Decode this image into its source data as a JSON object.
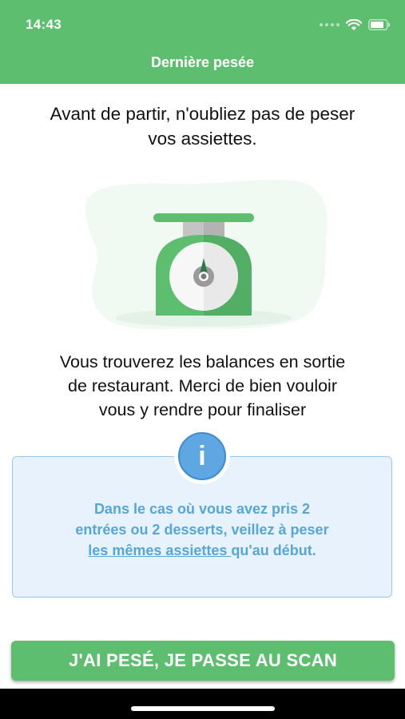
{
  "status_bar": {
    "time": "14:43"
  },
  "header": {
    "title": "Dernière pesée"
  },
  "intro": {
    "line1": "Avant de partir, n'oubliez pas de peser",
    "line2": "vos assiettes."
  },
  "illustration": {
    "icon": "kitchen-scale-icon"
  },
  "scales_info": {
    "line1": "Vous trouverez les balances en sortie",
    "line2": "de restaurant. Merci de bien vouloir",
    "line3": "vous y rendre pour finaliser"
  },
  "info_box": {
    "icon_glyph": "i",
    "line1": "Dans le cas où vous avez pris 2",
    "line2": "entrées ou 2 desserts, veillez à peser",
    "link_text": "les mêmes assiettes ",
    "line3_rest": "qu'au début."
  },
  "cta": {
    "label": "J'AI PESÉ, JE PASSE AU SCAN"
  },
  "colors": {
    "brand_green": "#5ebe70",
    "info_blue": "#5fa7e3",
    "info_text": "#56a7d8",
    "info_bg": "#e7f2fc"
  }
}
